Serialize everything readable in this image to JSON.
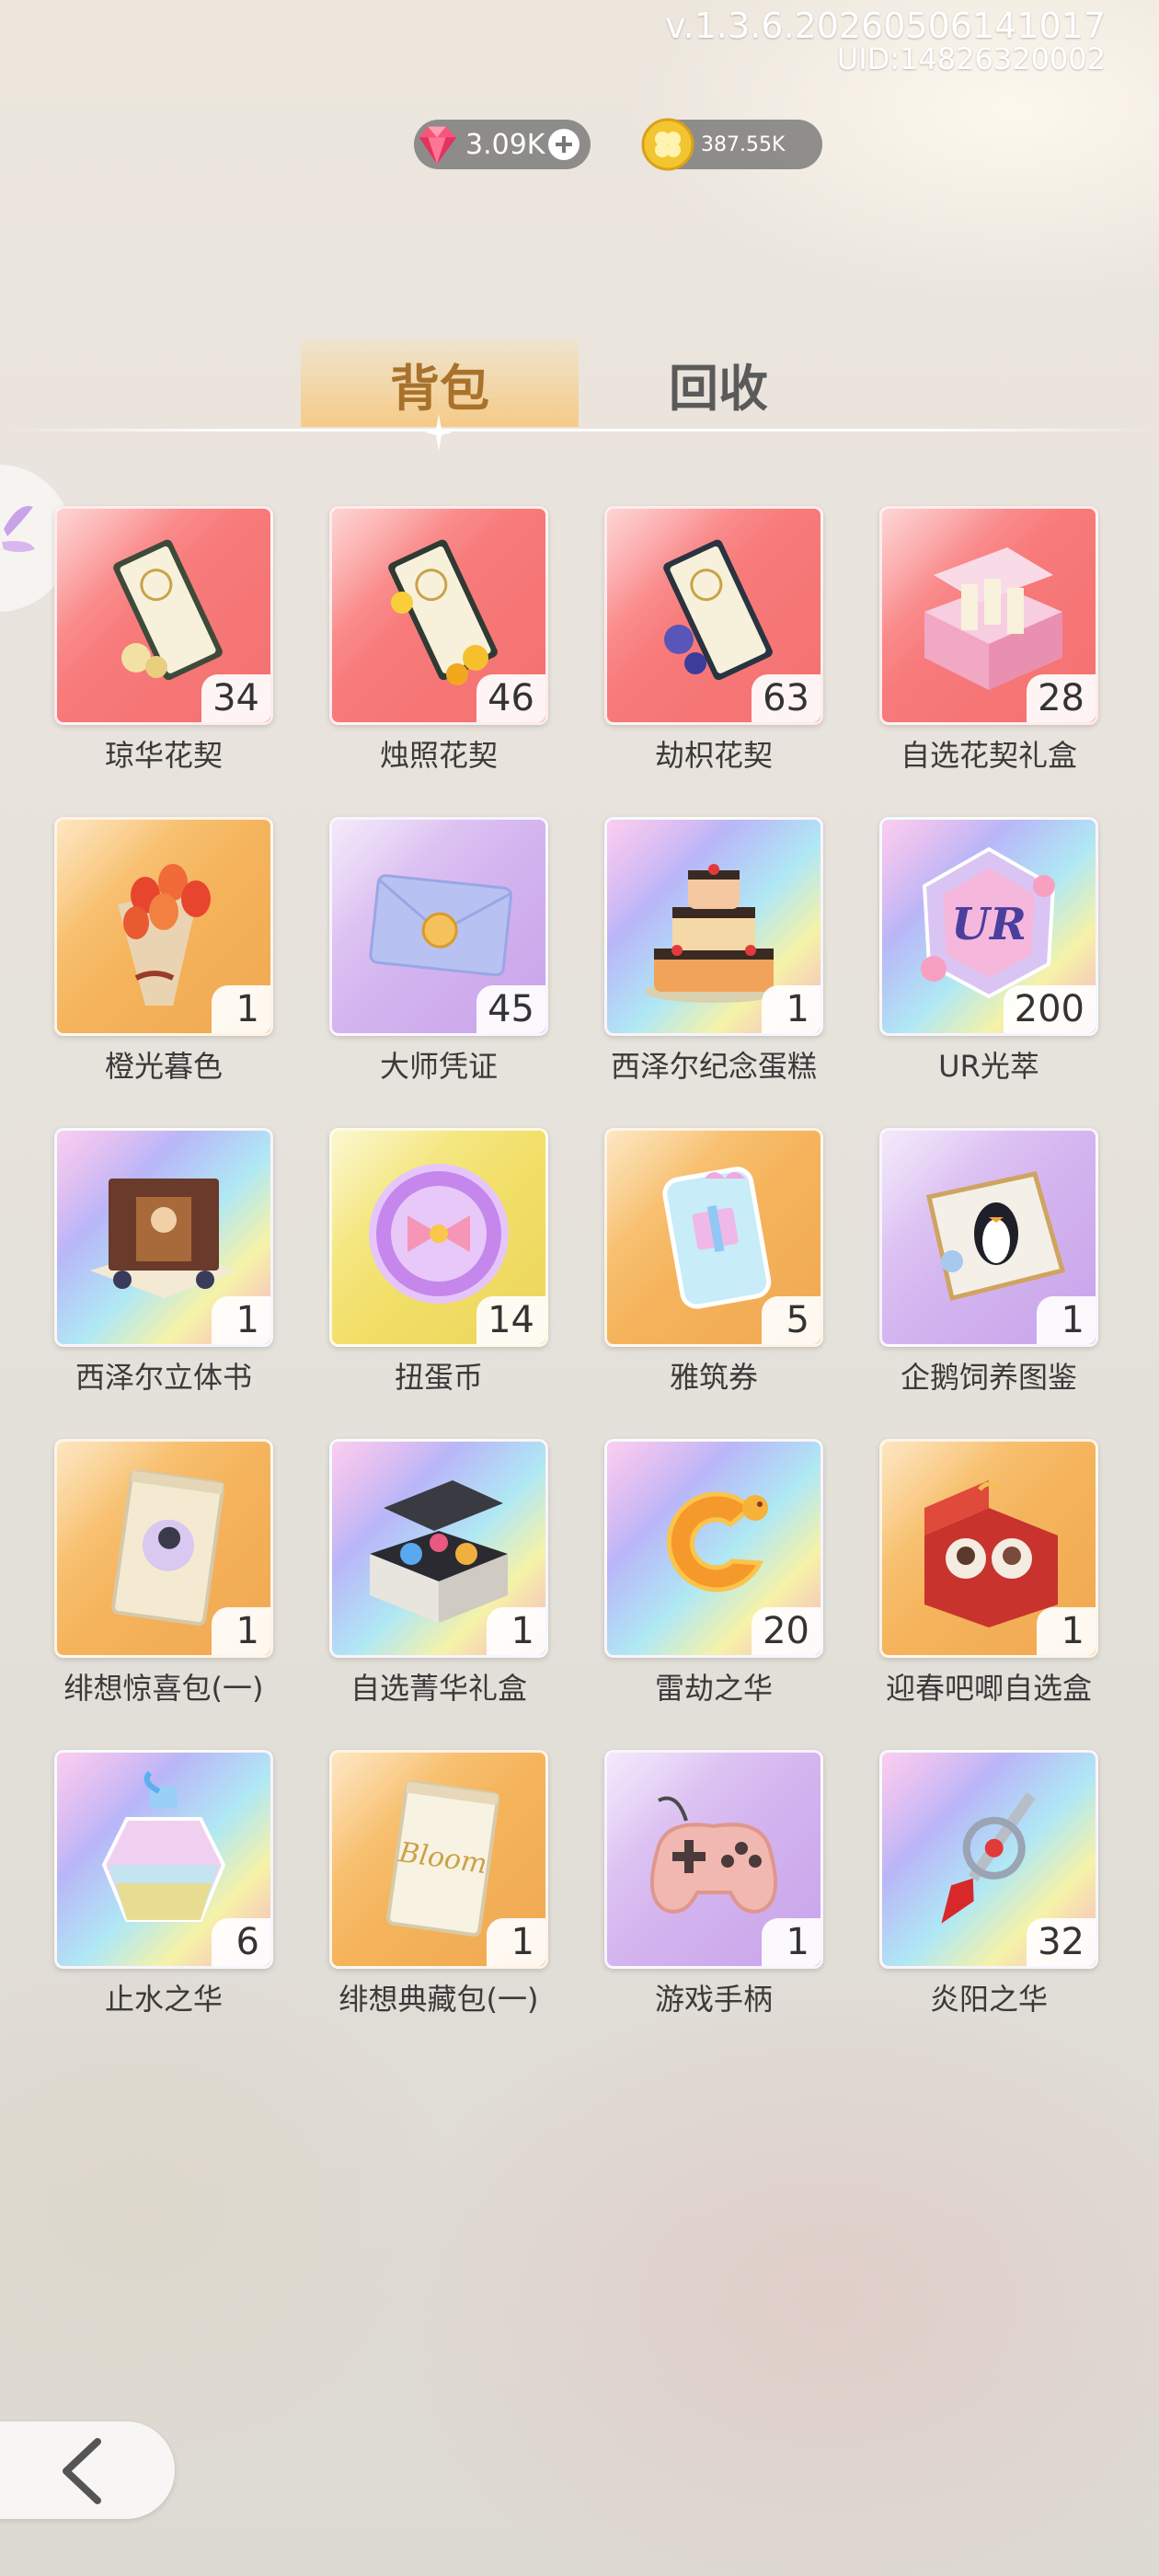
{
  "header": {
    "version": "v.1.3.6.20260506141017",
    "uid": "UID:14826320002"
  },
  "currency": {
    "gems": {
      "icon": "pink-diamond-icon",
      "value": "3.09K"
    },
    "coins": {
      "icon": "gold-clover-coin-icon",
      "value": "387.55K"
    }
  },
  "tabs": [
    {
      "label": "背包",
      "active": true
    },
    {
      "label": "回收",
      "active": false
    }
  ],
  "items": [
    {
      "name": "琼华花契",
      "count": "34",
      "bg": "red",
      "icon": "scroll-contract-icon"
    },
    {
      "name": "烛照花契",
      "count": "46",
      "bg": "red",
      "icon": "scroll-contract-icon"
    },
    {
      "name": "劫枳花契",
      "count": "63",
      "bg": "red",
      "icon": "scroll-contract-icon"
    },
    {
      "name": "自选花契礼盒",
      "count": "28",
      "bg": "red",
      "icon": "gift-box-icon"
    },
    {
      "name": "橙光暮色",
      "count": "1",
      "bg": "orange",
      "icon": "tulip-bouquet-icon"
    },
    {
      "name": "大师凭证",
      "count": "45",
      "bg": "purple",
      "icon": "envelope-icon"
    },
    {
      "name": "西泽尔纪念蛋糕",
      "count": "1",
      "bg": "rainbow",
      "icon": "cake-icon"
    },
    {
      "name": "UR光萃",
      "count": "200",
      "bg": "rainbow",
      "icon": "ur-crystal-icon"
    },
    {
      "name": "西泽尔立体书",
      "count": "1",
      "bg": "rainbow",
      "icon": "popup-book-icon"
    },
    {
      "name": "扭蛋币",
      "count": "14",
      "bg": "yellow",
      "icon": "gacha-coin-icon"
    },
    {
      "name": "雅筑券",
      "count": "5",
      "bg": "orange",
      "icon": "ticket-icon"
    },
    {
      "name": "企鹅饲养图鉴",
      "count": "1",
      "bg": "purple",
      "icon": "penguin-book-icon"
    },
    {
      "name": "绯想惊喜包(一)",
      "count": "1",
      "bg": "orange",
      "icon": "card-pack-icon"
    },
    {
      "name": "自选菁华礼盒",
      "count": "1",
      "bg": "rainbow",
      "icon": "gift-box-icon"
    },
    {
      "name": "雷劫之华",
      "count": "20",
      "bg": "rainbow",
      "icon": "dragon-ring-icon"
    },
    {
      "name": "迎春吧唧自选盒",
      "count": "1",
      "bg": "orange",
      "icon": "badge-box-icon"
    },
    {
      "name": "止水之华",
      "count": "6",
      "bg": "rainbow",
      "icon": "potion-bottle-icon"
    },
    {
      "name": "绯想典藏包(一)",
      "count": "1",
      "bg": "orange",
      "icon": "card-pack-icon"
    },
    {
      "name": "游戏手柄",
      "count": "1",
      "bg": "purple",
      "icon": "gamepad-icon"
    },
    {
      "name": "炎阳之华",
      "count": "32",
      "bg": "rainbow",
      "icon": "red-gem-staff-icon"
    }
  ],
  "nav": {
    "back_icon": "back-arrow-icon"
  }
}
